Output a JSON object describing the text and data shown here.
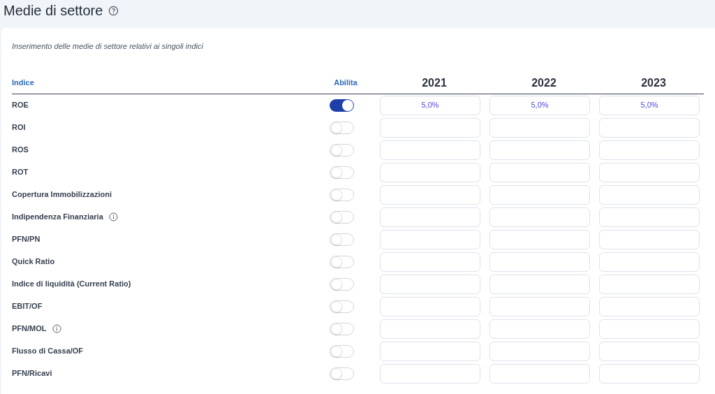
{
  "page": {
    "title": "Medie di settore"
  },
  "card": {
    "description": "Inserimento delle medie di settore relativi ai singoli indici"
  },
  "table": {
    "columns": {
      "index": "Indice",
      "enable": "Abilita",
      "years": [
        "2021",
        "2022",
        "2023"
      ]
    },
    "rows": [
      {
        "label": "ROE",
        "on": true,
        "values": [
          "5,0%",
          "5,0%",
          "5,0%"
        ]
      },
      {
        "label": "ROI",
        "on": false
      },
      {
        "label": "ROS",
        "on": false
      },
      {
        "label": "ROT",
        "on": false
      },
      {
        "label": "Copertura Immobilizzazioni",
        "on": false
      },
      {
        "label": "Indipendenza Finanziaria",
        "on": false,
        "info": true
      },
      {
        "label": "PFN/PN",
        "on": false
      },
      {
        "label": "Quick Ratio",
        "on": false
      },
      {
        "label": "Indice di liquidità (Current Ratio)",
        "on": false
      },
      {
        "label": "EBIT/OF",
        "on": false
      },
      {
        "label": "PFN/MOL",
        "on": false,
        "info": true
      },
      {
        "label": "Flusso di Cassa/OF",
        "on": false
      },
      {
        "label": "PFN/Ricavi",
        "on": false
      }
    ]
  }
}
